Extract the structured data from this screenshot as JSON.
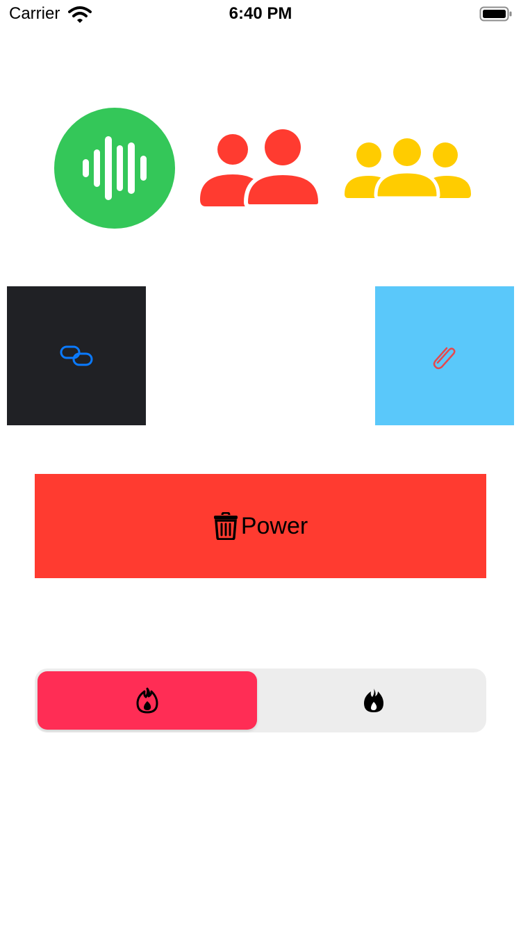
{
  "status_bar": {
    "carrier": "Carrier",
    "time": "6:40 PM",
    "icons": [
      "wifi-icon",
      "battery-icon"
    ]
  },
  "icon_row": {
    "items": [
      {
        "icon": "waveform-circle-icon",
        "color": "#34C759"
      },
      {
        "icon": "two-person-icon",
        "color": "#FF3B30"
      },
      {
        "icon": "three-person-icon",
        "color": "#FFCC00"
      }
    ]
  },
  "tiles": [
    {
      "icon": "link-icon",
      "background": "#202125",
      "icon_color": "#0A7AFF"
    },
    {
      "icon": "paperclip-icon",
      "background": "#5AC8FA",
      "icon_color": "#E5484D"
    }
  ],
  "power_button": {
    "label": "Power",
    "icon": "trash-icon",
    "background": "#FF3B30"
  },
  "segmented_control": {
    "selected_index": 0,
    "selected_color": "#FF2D55",
    "track_color": "#EDEDED",
    "segments": [
      {
        "icon": "flame-outline-icon"
      },
      {
        "icon": "flame-filled-icon"
      }
    ]
  }
}
